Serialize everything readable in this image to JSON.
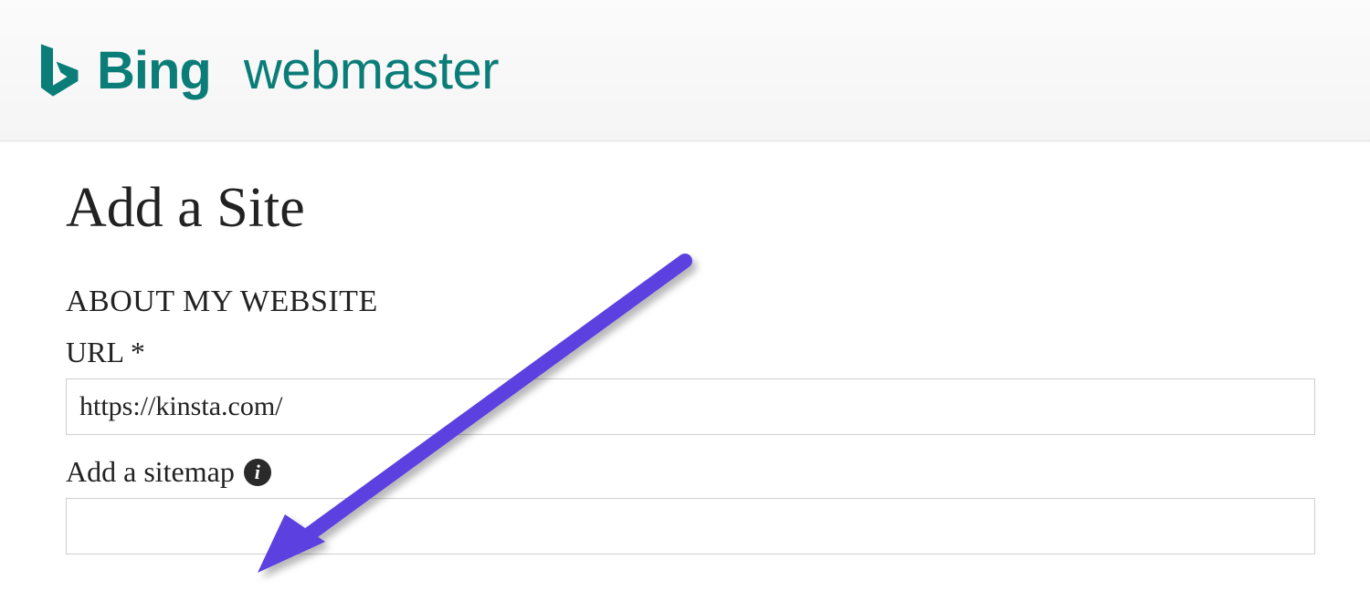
{
  "header": {
    "brand": "Bing",
    "product": "webmaster",
    "brand_color": "#0b7d78"
  },
  "page": {
    "title": "Add a Site"
  },
  "form": {
    "section_label": "ABOUT MY WEBSITE",
    "url_label": "URL *",
    "url_value": "https://kinsta.com/",
    "sitemap_label": "Add a sitemap",
    "sitemap_value": ""
  },
  "annotation": {
    "arrow_color": "#5b3fe0"
  }
}
